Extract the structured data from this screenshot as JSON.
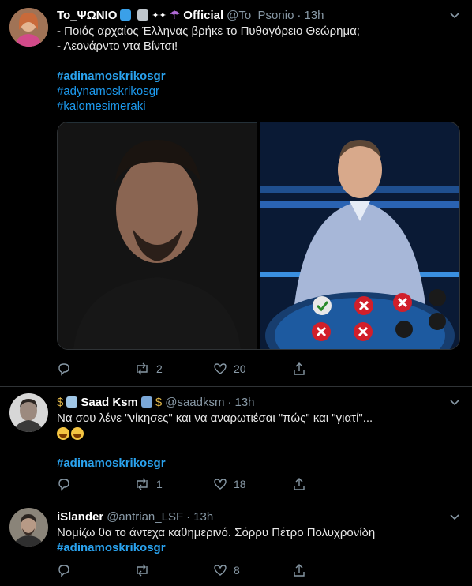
{
  "tweets": [
    {
      "name": "To_ΨΩΝΙΟ",
      "name_suffix": "Official",
      "handle": "@To_Psonio",
      "time": "13h",
      "lines": [
        "- Ποιός αρχαίος Έλληνας βρήκε το Πυθαγόρειο Θεώρημα;",
        "- Λεονάρντο ντα Βίντσι!"
      ],
      "hashtags": [
        "#adinamoskrikosgr",
        "#adynamoskrikosgr",
        "#kalomesimeraki"
      ],
      "replies": "",
      "retweets": "2",
      "likes": "20"
    },
    {
      "name": "Saad Ksm",
      "handle": "@saadksm",
      "time": "13h",
      "lines": [
        "Να σου λένε \"νίκησες\" και να αναρωτιέσαι \"πώς\" και \"γιατί\"..."
      ],
      "hashtags": [
        "#adinamoskrikosgr"
      ],
      "replies": "",
      "retweets": "1",
      "likes": "18"
    },
    {
      "name": "iSlander",
      "handle": "@antrian_LSF",
      "time": "13h",
      "lines": [
        "Νομίζω θα το άντεχα καθημερινό. Σόρρυ Πέτρο Πολυχρονίδη"
      ],
      "hashtags": [
        "#adinamoskrikosgr"
      ],
      "replies": "",
      "retweets": "",
      "likes": "8"
    }
  ],
  "colors": {
    "background": "#000000",
    "link": "#1d9bf0",
    "muted": "#8899a6",
    "divider": "#2f3336"
  }
}
